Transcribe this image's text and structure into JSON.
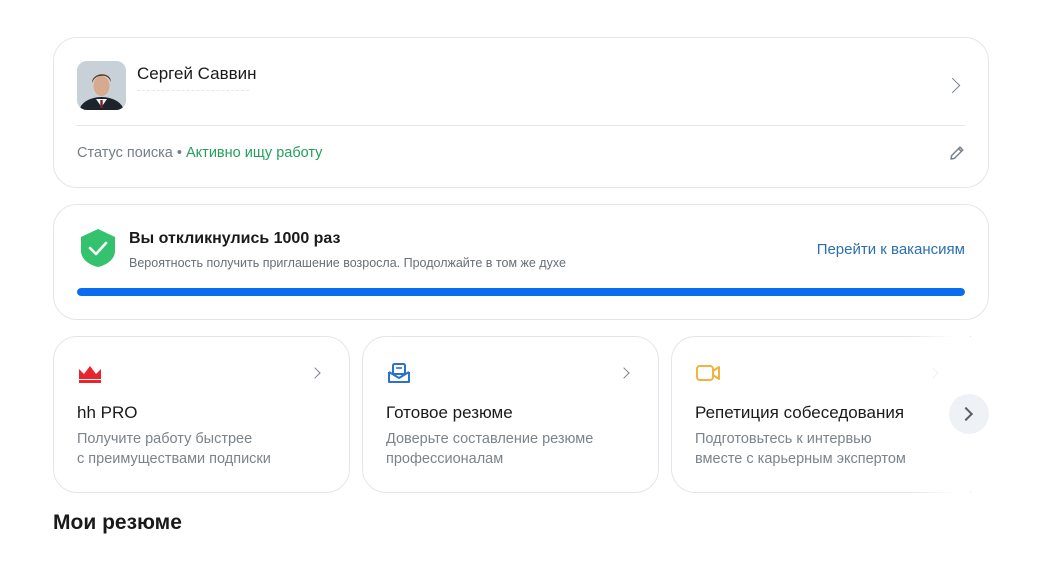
{
  "profile": {
    "name": "Сергей Саввин",
    "status_label": "Статус поиска",
    "status_separator": " • ",
    "status_value": "Активно ищу работу"
  },
  "responses": {
    "title": "Вы откликнулись 1000 раз",
    "subtitle": "Вероятность получить приглашение возросла. Продолжайте в том же духе",
    "link": "Перейти к вакансиям",
    "progress": 1.0
  },
  "services": [
    {
      "icon": "crown-icon",
      "title": "hh PRO",
      "desc_line1": "Получите работу быстрее",
      "desc_line2": "с преимуществами подписки"
    },
    {
      "icon": "envelope-resume-icon",
      "title": "Готовое резюме",
      "desc_line1": "Доверьте составление резюме",
      "desc_line2": "профессионалам"
    },
    {
      "icon": "video-camera-icon",
      "title": "Репетиция собеседования",
      "desc_line1": "Подготовьтесь к интервью",
      "desc_line2": "вместе с карьерным экспертом"
    }
  ],
  "colors": {
    "accent_green": "#22a05b",
    "link_blue": "#2b6fb0",
    "progress_blue": "#0a6cf0",
    "crown_red": "#e8242c",
    "envelope_blue": "#2b72c9",
    "camera_yellow": "#f0b43c"
  },
  "my_resumes_title": "Мои резюме"
}
